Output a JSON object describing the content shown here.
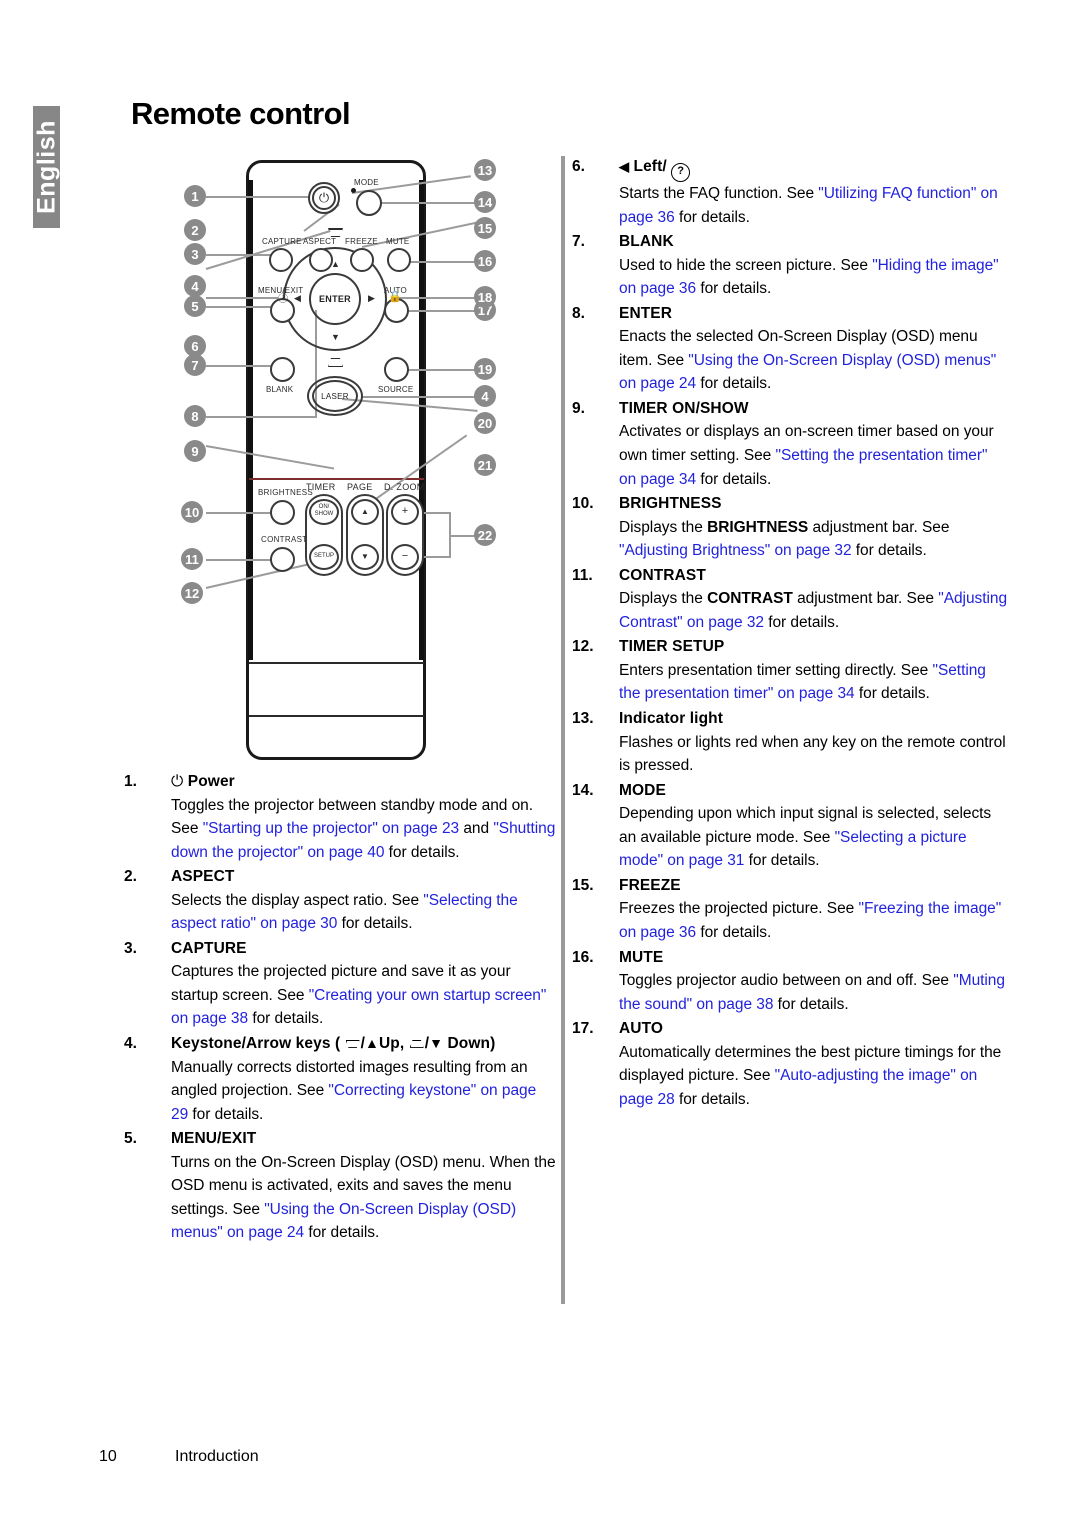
{
  "language_tab": "English",
  "page_title": "Remote control",
  "footer": {
    "page_number": "10",
    "section": "Introduction"
  },
  "remote": {
    "button_labels": {
      "mode": "MODE",
      "capture": "CAPTURE",
      "aspect": "ASPECT",
      "freeze": "FREEZE",
      "mute": "MUTE",
      "menu_exit": "MENU/EXIT",
      "auto": "AUTO",
      "blank": "BLANK",
      "source": "SOURCE",
      "enter": "ENTER",
      "laser": "LASER",
      "brightness": "BRIGHTNESS",
      "contrast": "CONTRAST",
      "timer": "TIMER",
      "timer_on_show_line1": "ON/",
      "timer_on_show_line2": "SHOW",
      "timer_setup": "SETUP",
      "page": "PAGE",
      "d_zoom": "D. ZOOM",
      "zoom_plus": "+",
      "zoom_minus": "−",
      "page_up": "▲",
      "page_down": "▼",
      "arrow_up": "▲",
      "arrow_down": "▼",
      "arrow_left": "◀",
      "arrow_right": "▶",
      "power_glyph": "⏻"
    },
    "callouts": [
      "1",
      "2",
      "3",
      "4",
      "5",
      "6",
      "7",
      "8",
      "9",
      "10",
      "11",
      "12",
      "13",
      "14",
      "15",
      "16",
      "17",
      "18",
      "19",
      "20",
      "21",
      "22",
      "4"
    ]
  },
  "left_column": [
    {
      "num": "1.",
      "header_prefix": "⏻",
      "header": "Power",
      "body": [
        {
          "t": "Toggles the projector between standby mode and on. See ",
          "k": "n"
        },
        {
          "t": "\"Starting up the projector\" on page 23",
          "k": "l"
        },
        {
          "t": " and ",
          "k": "n"
        },
        {
          "t": "\"Shutting down the projector\" on page 40",
          "k": "l"
        },
        {
          "t": " for details.",
          "k": "n"
        }
      ]
    },
    {
      "num": "2.",
      "header": "ASPECT",
      "body": [
        {
          "t": "Selects the display aspect ratio. See ",
          "k": "n"
        },
        {
          "t": "\"Selecting the aspect ratio\" on page 30",
          "k": "l"
        },
        {
          "t": " for details.",
          "k": "n"
        }
      ]
    },
    {
      "num": "3.",
      "header": "CAPTURE",
      "body": [
        {
          "t": "Captures the projected picture and save it as your startup screen. See ",
          "k": "n"
        },
        {
          "t": "\"Creating your own startup screen\" on page 38",
          "k": "l"
        },
        {
          "t": " for details.",
          "k": "n"
        }
      ]
    },
    {
      "num": "4.",
      "header": "Keystone/Arrow keys ( ▭ / ▲ Up, ▭ / ▼ Down)",
      "body": [
        {
          "t": "Manually corrects distorted images resulting from an angled projection. See ",
          "k": "n"
        },
        {
          "t": "\"Correcting keystone\" on page 29",
          "k": "l"
        },
        {
          "t": " for details.",
          "k": "n"
        }
      ]
    },
    {
      "num": "5.",
      "header": "MENU/EXIT",
      "body": [
        {
          "t": "Turns on the On-Screen Display (OSD) menu. When the OSD menu is activated, exits and saves the menu settings. See ",
          "k": "n"
        },
        {
          "t": "\"Using the On-Screen Display (OSD) menus\" on page 24",
          "k": "l"
        },
        {
          "t": " for details.",
          "k": "n"
        }
      ]
    }
  ],
  "right_column": [
    {
      "num": "6.",
      "header": "◀ Left/ ?",
      "body": [
        {
          "t": "Starts the FAQ function. See ",
          "k": "n"
        },
        {
          "t": "\"Utilizing FAQ function\" on page 36",
          "k": "l"
        },
        {
          "t": " for details.",
          "k": "n"
        }
      ]
    },
    {
      "num": "7.",
      "header": "BLANK",
      "body": [
        {
          "t": "Used to hide the screen picture. See ",
          "k": "n"
        },
        {
          "t": "\"Hiding the image\" on page 36",
          "k": "l"
        },
        {
          "t": " for details.",
          "k": "n"
        }
      ]
    },
    {
      "num": "8.",
      "header": "ENTER",
      "body": [
        {
          "t": "Enacts the selected On-Screen Display (OSD) menu item. See ",
          "k": "n"
        },
        {
          "t": "\"Using the On-Screen Display (OSD) menus\" on page 24",
          "k": "l"
        },
        {
          "t": " for details.",
          "k": "n"
        }
      ]
    },
    {
      "num": "9.",
      "header": "TIMER ON/SHOW",
      "body": [
        {
          "t": "Activates or displays an on-screen timer based on your own timer setting. See ",
          "k": "n"
        },
        {
          "t": "\"Setting the presentation timer\" on page 34",
          "k": "l"
        },
        {
          "t": " for details.",
          "k": "n"
        }
      ]
    },
    {
      "num": "10.",
      "header": "BRIGHTNESS",
      "body": [
        {
          "t": "Displays the ",
          "k": "n"
        },
        {
          "t": "BRIGHTNESS",
          "k": "b"
        },
        {
          "t": " adjustment bar. See ",
          "k": "n"
        },
        {
          "t": "\"Adjusting Brightness\" on page 32",
          "k": "l"
        },
        {
          "t": " for details.",
          "k": "n"
        }
      ]
    },
    {
      "num": "11.",
      "header": "CONTRAST",
      "body": [
        {
          "t": "Displays the ",
          "k": "n"
        },
        {
          "t": "CONTRAST",
          "k": "b"
        },
        {
          "t": " adjustment bar. See ",
          "k": "n"
        },
        {
          "t": "\"Adjusting Contrast\" on page 32",
          "k": "l"
        },
        {
          "t": " for details.",
          "k": "n"
        }
      ]
    },
    {
      "num": "12.",
      "header": "TIMER SETUP",
      "body": [
        {
          "t": "Enters presentation timer setting directly. See ",
          "k": "n"
        },
        {
          "t": "\"Setting the presentation timer\" on page 34",
          "k": "l"
        },
        {
          "t": " for details.",
          "k": "n"
        }
      ]
    },
    {
      "num": "13.",
      "header": "Indicator light",
      "body": [
        {
          "t": "Flashes or lights red when any key on the remote control is pressed.",
          "k": "n"
        }
      ]
    },
    {
      "num": "14.",
      "header": "MODE",
      "body": [
        {
          "t": "Depending upon which input signal is selected, selects an available picture mode. See ",
          "k": "n"
        },
        {
          "t": "\"Selecting a picture mode\" on page 31",
          "k": "l"
        },
        {
          "t": " for details.",
          "k": "n"
        }
      ]
    },
    {
      "num": "15.",
      "header": "FREEZE",
      "body": [
        {
          "t": "Freezes the projected picture. See ",
          "k": "n"
        },
        {
          "t": "\"Freezing the image\" on page 36",
          "k": "l"
        },
        {
          "t": " for details.",
          "k": "n"
        }
      ]
    },
    {
      "num": "16.",
      "header": "MUTE",
      "body": [
        {
          "t": "Toggles projector audio between on and off. See ",
          "k": "n"
        },
        {
          "t": "\"Muting the sound\" on page 38",
          "k": "l"
        },
        {
          "t": " for details.",
          "k": "n"
        }
      ]
    },
    {
      "num": "17.",
      "header": "AUTO",
      "body": [
        {
          "t": "Automatically determines the best picture timings for the displayed picture. See ",
          "k": "n"
        },
        {
          "t": "\"Auto-adjusting the image\" on page 28",
          "k": "l"
        },
        {
          "t": " for details.",
          "k": "n"
        }
      ]
    }
  ]
}
